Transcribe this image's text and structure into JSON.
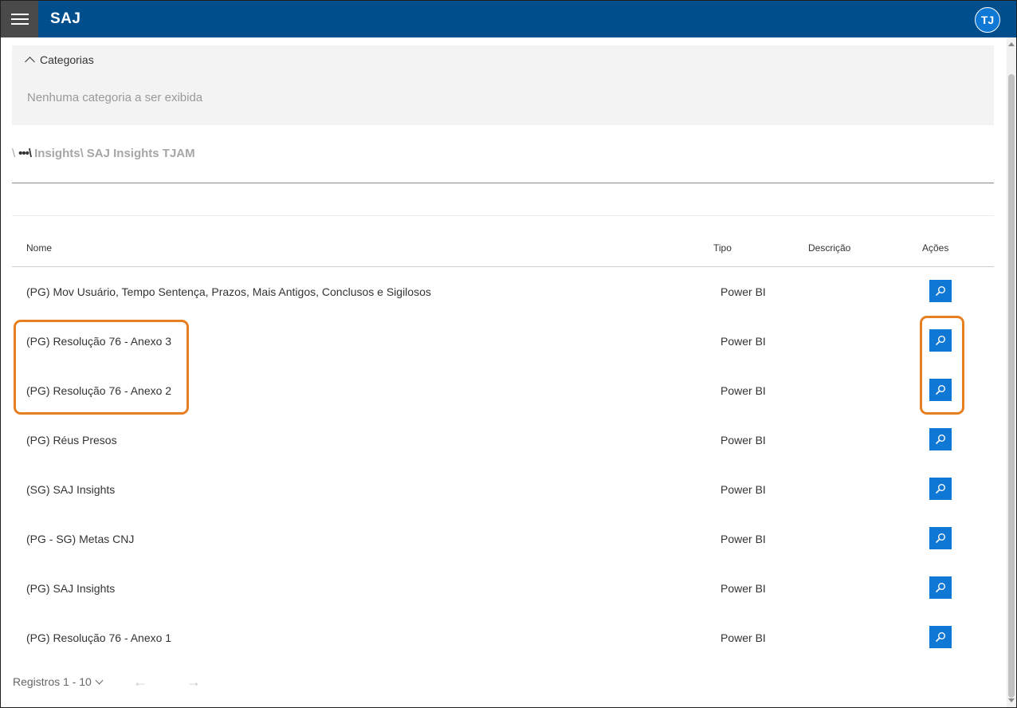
{
  "app": {
    "brand": "SAJ",
    "user_initials": "TJ"
  },
  "categories": {
    "title": "Categorias",
    "empty_text": "Nenhuma categoria a ser exibida"
  },
  "breadcrumb": {
    "root": "\\",
    "ellipsis": "•••\\",
    "items": [
      "Insights\\",
      "SAJ Insights TJAM"
    ]
  },
  "table": {
    "headers": {
      "name": "Nome",
      "type": "Tipo",
      "description": "Descrição",
      "actions": "Ações"
    },
    "rows": [
      {
        "name": "(PG) Mov Usuário, Tempo Sentença, Prazos, Mais Antigos, Conclusos e Sigilosos",
        "type": "Power BI"
      },
      {
        "name": "(PG) Resolução 76 - Anexo 3",
        "type": "Power BI"
      },
      {
        "name": "(PG) Resolução 76 - Anexo 2",
        "type": "Power BI"
      },
      {
        "name": "(PG) Réus Presos",
        "type": "Power BI"
      },
      {
        "name": "(SG) SAJ Insights",
        "type": "Power BI"
      },
      {
        "name": "(PG - SG) Metas CNJ",
        "type": "Power BI"
      },
      {
        "name": "(PG) SAJ Insights",
        "type": "Power BI"
      },
      {
        "name": "(PG) Resolução 76 - Anexo 1",
        "type": "Power BI"
      }
    ]
  },
  "footer": {
    "records_label": "Registros 1 - 10",
    "prev": "←",
    "next": "→"
  },
  "colors": {
    "header_bg": "#004e8c",
    "accent": "#0f78d4",
    "highlight": "#e67e22"
  }
}
